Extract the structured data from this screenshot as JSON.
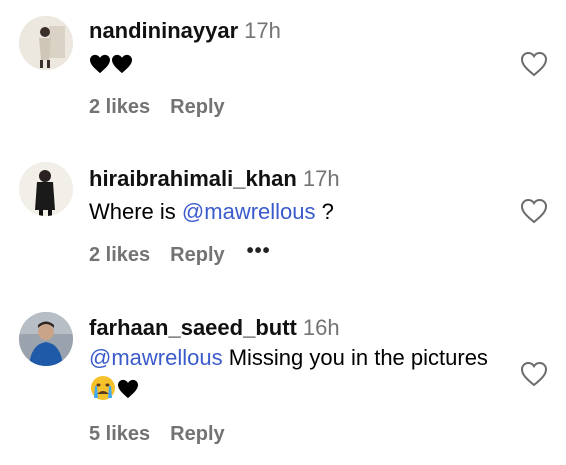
{
  "comments": [
    {
      "username": "nandininayyar",
      "time": "17h",
      "text_emoji": "🖤🖤",
      "likes": "2 likes",
      "reply": "Reply",
      "more": ""
    },
    {
      "username": "hiraibrahimali_khan",
      "time": "17h",
      "text_prefix": "Where is ",
      "mention": "@mawrellous",
      "text_suffix": " ?",
      "likes": "2 likes",
      "reply": "Reply",
      "more": "•••"
    },
    {
      "username": "farhaan_saeed_butt",
      "time": "16h",
      "mention": "@mawrellous",
      "text_suffix": " Missing you in the pictures ",
      "likes": "5 likes",
      "reply": "Reply"
    }
  ],
  "icons": {
    "like": "heart-outline-icon",
    "emoji": [
      "black-heart-icon",
      "crying-face-icon"
    ]
  },
  "colors": {
    "mention": "#3b5bcc",
    "meta": "#737373"
  }
}
